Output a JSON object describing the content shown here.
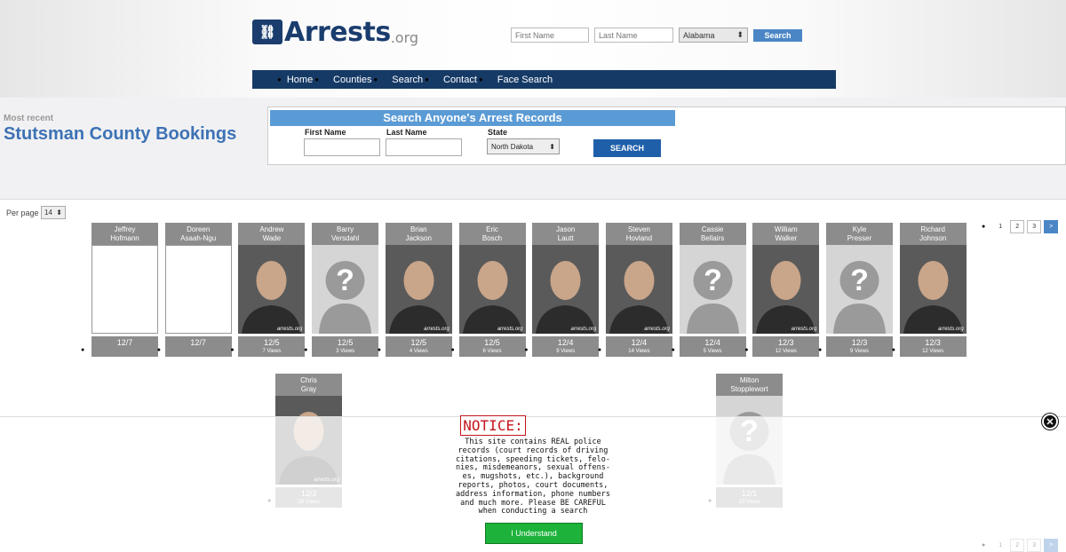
{
  "site": {
    "logo": "Arrests",
    "logo_suffix": ".org"
  },
  "top_search": {
    "first_placeholder": "First Name",
    "last_placeholder": "Last Name",
    "state": "Alabama",
    "button": "Search"
  },
  "nav": [
    "Home",
    "Counties",
    "Search",
    "Contact",
    "Face Search"
  ],
  "header": {
    "kicker": "Most recent",
    "title": "Stutsman County Bookings"
  },
  "search_panel": {
    "banner": "Search Anyone's Arrest Records",
    "first_label": "First Name",
    "last_label": "Last Name",
    "state_label": "State",
    "state_value": "North Dakota",
    "button": "SEARCH"
  },
  "per_page": {
    "label": "Per page",
    "value": "14"
  },
  "pagination": {
    "pages": [
      "1",
      "2",
      "3"
    ],
    "next": ">"
  },
  "bookings": [
    {
      "first": "Jeffrey",
      "last": "Hofmann",
      "date": "12/7",
      "views": "",
      "photo": "blank"
    },
    {
      "first": "Doreen",
      "last": "Asaah-Ngu",
      "date": "12/7",
      "views": "",
      "photo": "blank"
    },
    {
      "first": "Andrew",
      "last": "Wade",
      "date": "12/5",
      "views": "7 Views",
      "photo": "mugshot"
    },
    {
      "first": "Barry",
      "last": "Versdahl",
      "date": "12/5",
      "views": "3 Views",
      "photo": "unknown"
    },
    {
      "first": "Brian",
      "last": "Jackson",
      "date": "12/5",
      "views": "4 Views",
      "photo": "mugshot"
    },
    {
      "first": "Eric",
      "last": "Bosch",
      "date": "12/5",
      "views": "6 Views",
      "photo": "mugshot"
    },
    {
      "first": "Jason",
      "last": "Lautt",
      "date": "12/4",
      "views": "9 Views",
      "photo": "mugshot"
    },
    {
      "first": "Steven",
      "last": "Hovland",
      "date": "12/4",
      "views": "14 Views",
      "photo": "mugshot"
    },
    {
      "first": "Cassie",
      "last": "Bellairs",
      "date": "12/4",
      "views": "5 Views",
      "photo": "unknown"
    },
    {
      "first": "William",
      "last": "Walker",
      "date": "12/3",
      "views": "12 Views",
      "photo": "mugshot"
    },
    {
      "first": "Kyle",
      "last": "Presser",
      "date": "12/3",
      "views": "9 Views",
      "photo": "unknown"
    },
    {
      "first": "Richard",
      "last": "Johnson",
      "date": "12/3",
      "views": "12 Views",
      "photo": "mugshot"
    },
    {
      "first": "Chris",
      "last": "Gray",
      "date": "12/3",
      "views": "28 Views",
      "photo": "mugshot"
    },
    {
      "first": "Milton",
      "last": "Stopplewort",
      "date": "12/1",
      "views": "13 Views",
      "photo": "unknown"
    }
  ],
  "watermark": "arrests.org",
  "notice": {
    "title": "NOTICE:",
    "body": "This site contains REAL police\nrecords (court records of driving\ncitations, speeding tickets, felo-\nnies, misdemeanors, sexual offens-\nes, mugshots, etc.), background\nreports, photos, court documents,\naddress information, phone numbers\nand much more. Please BE CAREFUL\nwhen conducting a search",
    "button": "I Understand"
  },
  "colors": {
    "nav_bg": "#163a66",
    "title_blue": "#3d72b5",
    "banner_blue": "#5b9bd5",
    "button_blue": "#1f5faa",
    "notice_red": "#c4161c",
    "understand_green": "#1db33a"
  }
}
